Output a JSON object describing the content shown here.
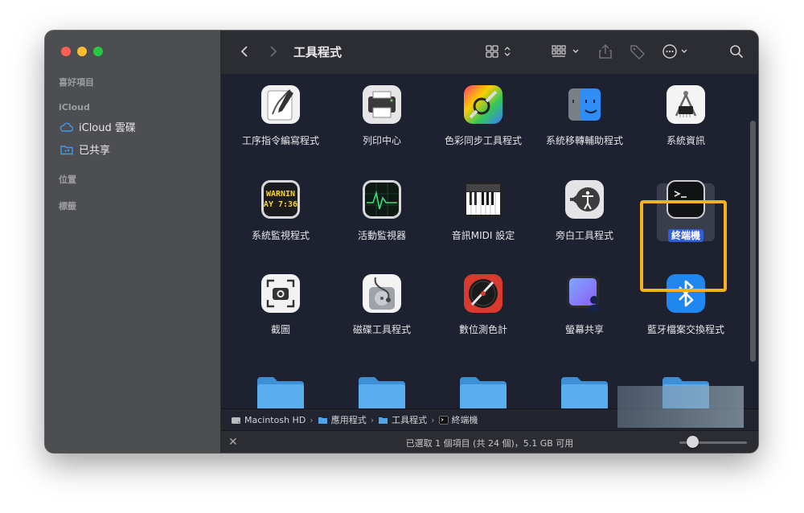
{
  "sidebar": {
    "sections": {
      "favorites": "喜好項目",
      "icloud": "iCloud",
      "locations": "位置",
      "tags": "標籤"
    },
    "items": [
      {
        "label": "iCloud 雲碟",
        "icon": "icloud-icon"
      },
      {
        "label": "已共享",
        "icon": "shared-folder-icon"
      }
    ]
  },
  "toolbar": {
    "title": "工具程式",
    "back_icon": "chevron-left-icon",
    "forward_icon": "chevron-right-icon",
    "view_icon": "grid-view-icon",
    "group_icon": "group-by-icon",
    "share_icon": "share-icon",
    "tag_icon": "tag-icon",
    "more_icon": "ellipsis-circle-icon",
    "search_icon": "search-icon"
  },
  "apps": [
    {
      "label": "工序指令編寫程式",
      "icon": "script-editor-icon"
    },
    {
      "label": "列印中心",
      "icon": "print-center-icon"
    },
    {
      "label": "色彩同步工具程式",
      "icon": "colorsync-icon"
    },
    {
      "label": "系統移轉輔助程式",
      "icon": "migration-assistant-icon"
    },
    {
      "label": "系統資訊",
      "icon": "system-information-icon"
    },
    {
      "label": "系統監視程式",
      "icon": "console-icon",
      "icon_text": [
        "WARNIN",
        "AY 7:36"
      ]
    },
    {
      "label": "活動監視器",
      "icon": "activity-monitor-icon"
    },
    {
      "label": "音訊MIDI 設定",
      "icon": "audio-midi-icon"
    },
    {
      "label": "旁白工具程式",
      "icon": "voiceover-icon"
    },
    {
      "label": "終端機",
      "icon": "terminal-icon",
      "selected": true
    },
    {
      "label": "截圖",
      "icon": "screenshot-icon"
    },
    {
      "label": "磁碟工具程式",
      "icon": "disk-utility-icon"
    },
    {
      "label": "數位測色計",
      "icon": "digital-color-meter-icon"
    },
    {
      "label": "螢幕共享",
      "icon": "screen-sharing-icon"
    },
    {
      "label": "藍牙檔案交換程式",
      "icon": "bluetooth-file-exchange-icon"
    }
  ],
  "pathbar": [
    {
      "label": "Macintosh HD",
      "icon": "hard-drive-icon"
    },
    {
      "label": "應用程式",
      "icon": "folder-icon"
    },
    {
      "label": "工具程式",
      "icon": "folder-icon"
    },
    {
      "label": "終端機",
      "icon": "terminal-small-icon"
    }
  ],
  "status": {
    "text": "已選取 1 個項目 (共 24 個)，5.1 GB 可用",
    "icon_size_fraction": 0.2
  },
  "colors": {
    "highlight": "#f4b223",
    "selection": "#2d5ed8",
    "folder": "#4fa3e8"
  }
}
